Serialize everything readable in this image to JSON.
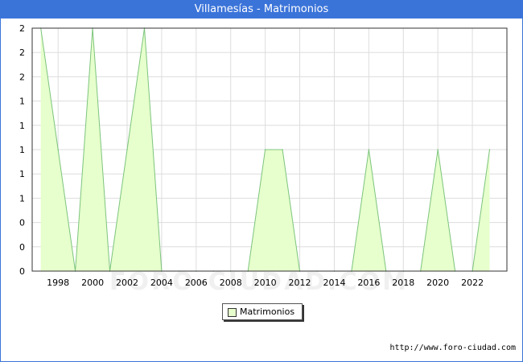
{
  "window": {
    "title": "Villamesías - Matrimonios"
  },
  "footer": {
    "source": "http://www.foro-ciudad.com"
  },
  "watermark": "FORO-CIUDAD.COM",
  "colors": {
    "titlebar": "#3b74d9",
    "area_fill": "#e6ffcc",
    "area_line": "#7dc47d",
    "grid": "#dddddd"
  },
  "chart_data": {
    "type": "area",
    "title": "Villamesías - Matrimonios",
    "xlabel": "",
    "ylabel": "",
    "x": [
      1997,
      1998,
      1999,
      2000,
      2001,
      2002,
      2003,
      2004,
      2005,
      2006,
      2007,
      2008,
      2009,
      2010,
      2011,
      2012,
      2013,
      2014,
      2015,
      2016,
      2017,
      2018,
      2019,
      2020,
      2021,
      2022,
      2023
    ],
    "series": [
      {
        "name": "Matrimonios",
        "values": [
          2,
          1,
          0,
          2,
          0,
          1,
          2,
          0,
          0,
          0,
          0,
          0,
          0,
          1,
          1,
          0,
          0,
          0,
          0,
          1,
          0,
          0,
          0,
          1,
          0,
          0,
          1
        ]
      }
    ],
    "x_tick_labels": [
      "1998",
      "2000",
      "2002",
      "2004",
      "2006",
      "2008",
      "2010",
      "2012",
      "2014",
      "2016",
      "2018",
      "2020",
      "2022"
    ],
    "y_tick_labels": [
      "0",
      "0",
      "0",
      "1",
      "1",
      "1",
      "1",
      "1",
      "2",
      "2",
      "2"
    ],
    "xlim": [
      1996.5,
      2024
    ],
    "ylim": [
      0,
      2
    ],
    "grid": true,
    "legend": {
      "position": "bottom-center",
      "entries": [
        "Matrimonios"
      ]
    }
  }
}
